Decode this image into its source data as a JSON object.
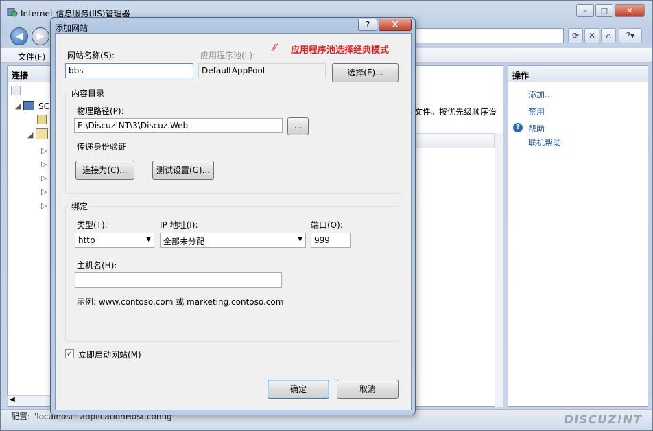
{
  "main": {
    "title": "Internet 信息服务(IIS)管理器",
    "menu_file": "文件(F)",
    "connections_header": "连接",
    "tree_root": "SC",
    "actions_header": "操作",
    "actions": [
      "添加...",
      "禁用",
      "帮助",
      "联机帮助"
    ],
    "content_snippet": "文件。按优先级顺序设",
    "status": "配置: \"localhost\" applicationHost.config",
    "watermark": "DISCUZ!NT"
  },
  "annotation": "应用程序池选择经典模式",
  "dialog": {
    "title": "添加网站",
    "help_label": "?",
    "close_label": "X",
    "site_name_label": "网站名称(S):",
    "site_name_value": "bbs",
    "app_pool_label": "应用程序池(L):",
    "app_pool_value": "DefaultAppPool",
    "select_button": "选择(E)...",
    "content_dir_group": "内容目录",
    "physical_path_label": "物理路径(P):",
    "physical_path_value": "E:\\Discuz!NT\\3\\Discuz.Web",
    "browse_button": "...",
    "pass_through_label": "传递身份验证",
    "connect_as_button": "连接为(C)...",
    "test_settings_button": "测试设置(G)...",
    "binding_group": "绑定",
    "type_label": "类型(T):",
    "type_value": "http",
    "ip_label": "IP 地址(I):",
    "ip_value": "全部未分配",
    "port_label": "端口(O):",
    "port_value": "999",
    "hostname_label": "主机名(H):",
    "hostname_value": "",
    "example_text": "示例: www.contoso.com 或 marketing.contoso.com",
    "start_now_label": "立即启动网站(M)",
    "start_now_checked": true,
    "ok_button": "确定",
    "cancel_button": "取消"
  }
}
